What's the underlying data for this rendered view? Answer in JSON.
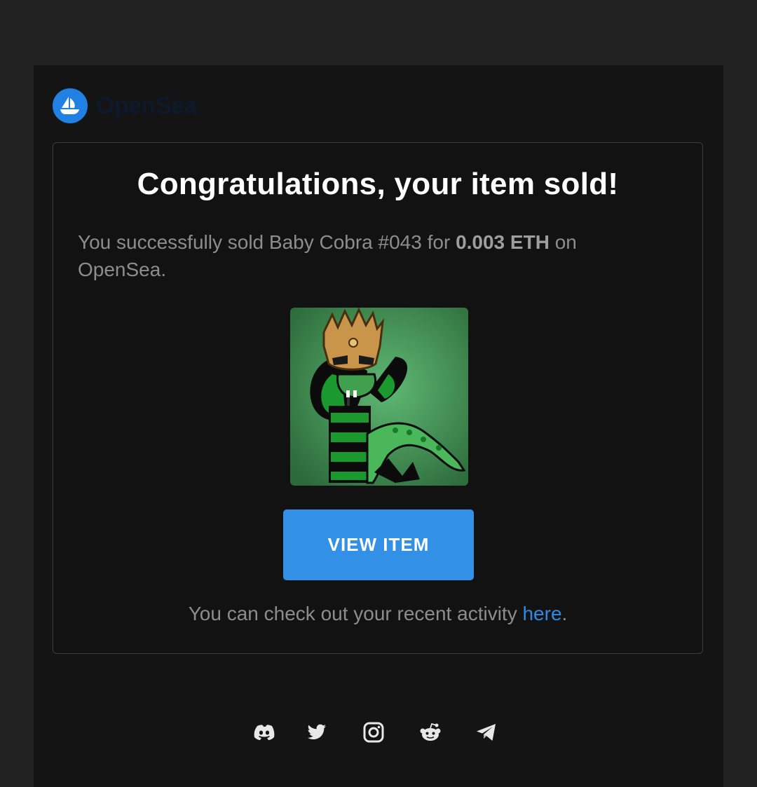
{
  "brand": {
    "logo_text": "OpenSea",
    "logo_icon": "opensea-ship-icon",
    "accent_color": "#2081e2"
  },
  "card": {
    "title": "Congratulations, your item sold!",
    "message_prefix": "You successfully sold Baby Cobra #043 for ",
    "price": "0.003 ETH",
    "message_suffix": " on OpenSea.",
    "nft_image": "baby-cobra-nft-image",
    "button_label": "VIEW ITEM",
    "button_color": "#3291e6",
    "activity_prefix": "You can check out your recent activity ",
    "activity_link": "here",
    "activity_suffix": "."
  },
  "social": [
    {
      "icon": "discord-icon"
    },
    {
      "icon": "twitter-icon"
    },
    {
      "icon": "instagram-icon"
    },
    {
      "icon": "reddit-icon"
    },
    {
      "icon": "telegram-icon"
    }
  ]
}
